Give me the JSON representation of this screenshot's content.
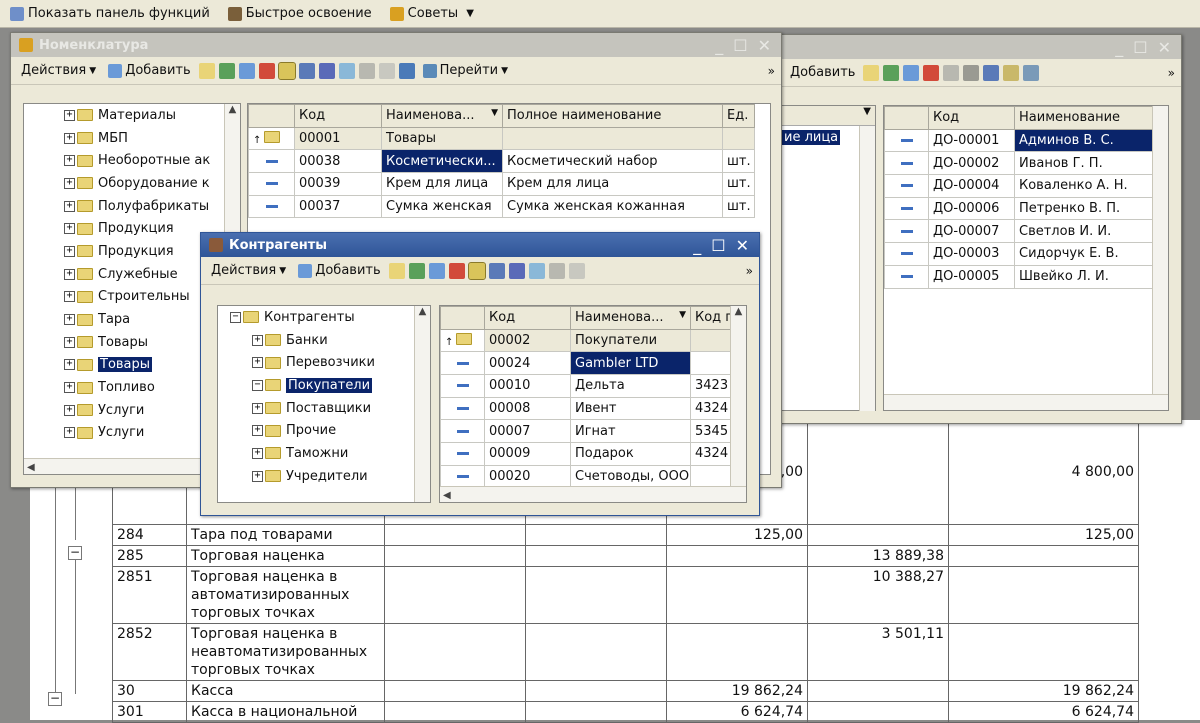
{
  "topbar": {
    "items": [
      "Показать панель функций",
      "Быстрое освоение",
      "Советы"
    ]
  },
  "report": {
    "rows": [
      {
        "code": "284",
        "name": "Тара под товарами",
        "c3": "",
        "c4": "",
        "c5": "125,00",
        "c6": "",
        "c7": "125,00"
      },
      {
        "code": "285",
        "name": "Торговая наценка",
        "c3": "",
        "c4": "",
        "c5": "",
        "c6": "13 889,38",
        "c7": ""
      },
      {
        "code": "2851",
        "name": "Торговая наценка в автоматизированных торговых точках",
        "c3": "",
        "c4": "",
        "c5": "",
        "c6": "10 388,27",
        "c7": ""
      },
      {
        "code": "2852",
        "name": "Торговая наценка в неавтоматизированных торговых точках",
        "c3": "",
        "c4": "",
        "c5": "",
        "c6": "3 501,11",
        "c7": ""
      },
      {
        "code": "30",
        "name": "Касса",
        "c3": "",
        "c4": "",
        "c5": "19 862,24",
        "c6": "",
        "c7": "19 862,24"
      }
    ],
    "partial_top": {
      "c5": "4 800,00",
      "c7": "4 800,00"
    },
    "partial_bottom": {
      "code": "301",
      "name": "Касса в национальной",
      "c5": "6 624,74",
      "c7": "6 624,74"
    }
  },
  "nomenclature": {
    "title": "Номенклатура",
    "toolbar": {
      "actions": "Действия",
      "add": "Добавить",
      "goto": "Перейти"
    },
    "tree": [
      "Материалы",
      "МБП",
      "Необоротные ак",
      "Оборудование к",
      "Полуфабрикаты",
      "Продукция",
      "Продукция",
      "Служебные",
      "Строительны",
      "Тара",
      "Товары",
      "Товары",
      "Топливо",
      "Услуги",
      "Услуги"
    ],
    "selected_tree_index": 11,
    "columns": [
      "Код",
      "Наименова...",
      "Полное наименование",
      "Ед."
    ],
    "rows": [
      {
        "code": "00001",
        "name": "Товары",
        "full": "",
        "unit": "",
        "folder": true
      },
      {
        "code": "00038",
        "name": "Косметически...",
        "full": "Косметический набор",
        "unit": "шт.",
        "selected": true
      },
      {
        "code": "00039",
        "name": "Крем для лица",
        "full": "Крем для лица",
        "unit": "шт."
      },
      {
        "code": "00037",
        "name": "Сумка женская",
        "full": "Сумка женская кожанная",
        "unit": "шт."
      }
    ]
  },
  "employees": {
    "toolbar": {
      "add": "Добавить"
    },
    "left_partial": "ие лица",
    "columns": [
      "Код",
      "Наименование"
    ],
    "rows": [
      {
        "code": "ДО-00001",
        "name": "Админов В. С.",
        "selected": true
      },
      {
        "code": "ДО-00002",
        "name": "Иванов Г. П."
      },
      {
        "code": "ДО-00004",
        "name": "Коваленко А. Н."
      },
      {
        "code": "ДО-00006",
        "name": "Петренко В. П."
      },
      {
        "code": "ДО-00007",
        "name": "Светлов И. И."
      },
      {
        "code": "ДО-00003",
        "name": "Сидорчук Е. В."
      },
      {
        "code": "ДО-00005",
        "name": "Швейко Л. И."
      }
    ]
  },
  "contragents": {
    "title": "Контрагенты",
    "toolbar": {
      "actions": "Действия",
      "add": "Добавить"
    },
    "tree_root": "Контрагенты",
    "tree": [
      "Банки",
      "Перевозчики",
      "Покупатели",
      "Поставщики",
      "Прочие",
      "Таможни",
      "Учредители"
    ],
    "selected_tree_index": 2,
    "columns": [
      "Код",
      "Наименова...",
      "Код п"
    ],
    "rows": [
      {
        "code": "00002",
        "name": "Покупатели",
        "kod": "",
        "folder": true
      },
      {
        "code": "00024",
        "name": "Gambler LTD",
        "kod": "",
        "selected": true
      },
      {
        "code": "00010",
        "name": "Дельта",
        "kod": "3423"
      },
      {
        "code": "00008",
        "name": "Ивент",
        "kod": "4324"
      },
      {
        "code": "00007",
        "name": "Игнат",
        "kod": "5345"
      },
      {
        "code": "00009",
        "name": "Подарок",
        "kod": "4324"
      },
      {
        "code": "00020",
        "name": "Счетоводы, ООО",
        "kod": ""
      }
    ]
  },
  "colors": {
    "selection": "#0a246a",
    "active_title": "#2f5597",
    "folder": "#e9d477"
  }
}
